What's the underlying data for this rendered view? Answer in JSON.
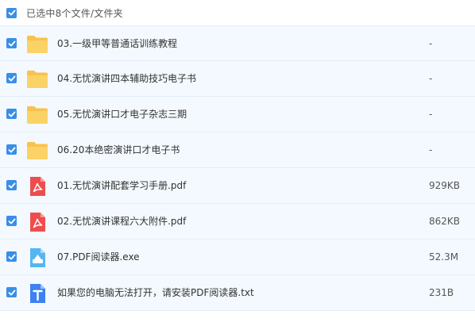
{
  "header": {
    "label": "已选中8个文件/文件夹",
    "checked": true
  },
  "colors": {
    "accent": "#3a8ee6",
    "row_bg": "#f3f9fe",
    "folder": "#f9c14d",
    "pdf": "#ee4d4d",
    "exe": "#54b7f1",
    "txt": "#3d82f0"
  },
  "files": [
    {
      "name": "03.一级甲等普通话训练教程",
      "size": "-",
      "icon": "folder-icon",
      "checked": true
    },
    {
      "name": "04.无忧演讲四本辅助技巧电子书",
      "size": "-",
      "icon": "folder-icon",
      "checked": true
    },
    {
      "name": "05.无忧演讲口才电子杂志三期",
      "size": "-",
      "icon": "folder-icon",
      "checked": true
    },
    {
      "name": "06.20本绝密演讲口才电子书",
      "size": "-",
      "icon": "folder-icon",
      "checked": true
    },
    {
      "name": "01.无忧演讲配套学习手册.pdf",
      "size": "929KB",
      "icon": "pdf-icon",
      "checked": true
    },
    {
      "name": "02.无忧演讲课程六大附件.pdf",
      "size": "862KB",
      "icon": "pdf-icon",
      "checked": true
    },
    {
      "name": "07.PDF阅读器.exe",
      "size": "52.3M",
      "icon": "exe-icon",
      "checked": true
    },
    {
      "name": "如果您的电脑无法打开，请安装PDF阅读器.txt",
      "size": "231B",
      "icon": "txt-icon",
      "checked": true
    }
  ]
}
